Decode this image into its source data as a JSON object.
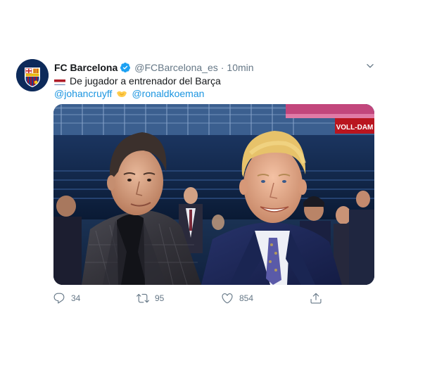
{
  "tweet": {
    "author": {
      "name": "FC Barcelona",
      "handle": "@FCBarcelona_es",
      "verified": true,
      "avatar_label": "FCB"
    },
    "separator": "·",
    "time": "10min",
    "text_line1": "De jugador a entrenador del Barça",
    "mention1": "@johancruyff",
    "mention2": "@ronaldkoeman",
    "media": {
      "banner_text": "VOLL-DAM"
    },
    "stats": {
      "replies": "34",
      "retweets": "95",
      "likes": "854"
    }
  },
  "colors": {
    "link": "#1b95e0",
    "muted": "#657786",
    "verified": "#1da1f2"
  },
  "icons": {
    "flag": "netherlands-flag-icon",
    "handshake": "handshake-icon",
    "caret": "chevron-down-icon",
    "reply": "reply-icon",
    "retweet": "retweet-icon",
    "like": "heart-icon",
    "share": "share-icon"
  }
}
